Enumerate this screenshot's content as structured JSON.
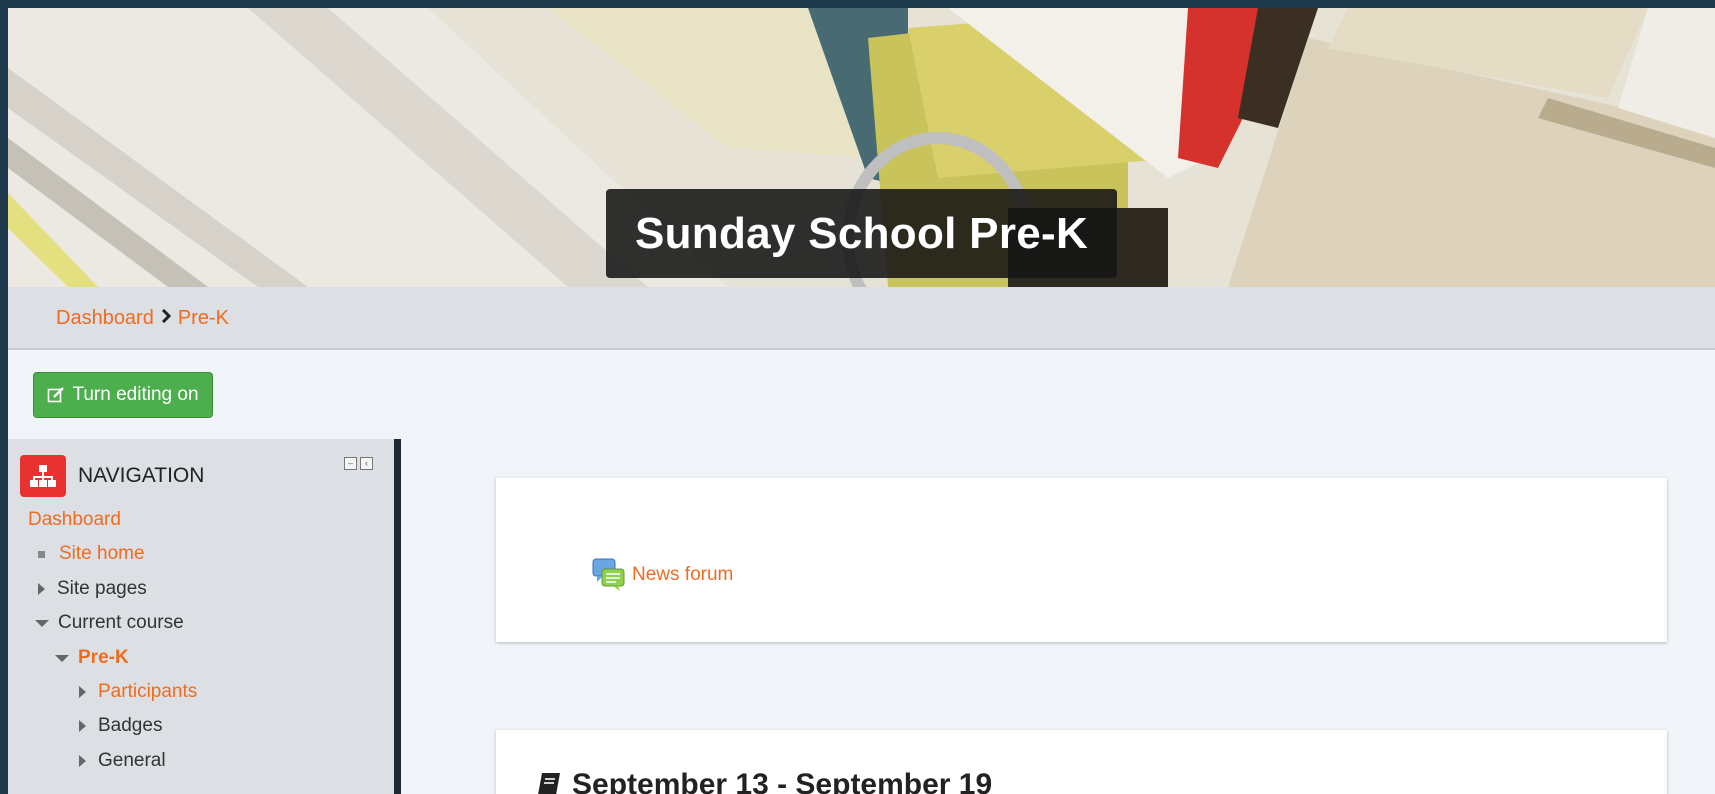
{
  "header": {
    "site_title": "Sunday School Pre-K"
  },
  "breadcrumb": {
    "items": [
      "Dashboard",
      "Pre-K"
    ],
    "separator": "›"
  },
  "toolbar": {
    "edit_label": "Turn editing on"
  },
  "navigation": {
    "title": "NAVIGATION",
    "items": [
      {
        "label": "Dashboard",
        "link": true,
        "marker": "none"
      },
      {
        "label": "Site home",
        "link": true,
        "marker": "bullet"
      },
      {
        "label": "Site pages",
        "link": false,
        "marker": "collapsed"
      },
      {
        "label": "Current course",
        "link": false,
        "marker": "expanded"
      },
      {
        "label": "Pre-K",
        "link": true,
        "marker": "expanded"
      },
      {
        "label": "Participants",
        "link": true,
        "marker": "collapsed"
      },
      {
        "label": "Badges",
        "link": false,
        "marker": "collapsed"
      },
      {
        "label": "General",
        "link": false,
        "marker": "collapsed"
      }
    ]
  },
  "main": {
    "news_forum_label": "News forum",
    "week_title": "September 13 - September 19"
  },
  "colors": {
    "accent": "#f26b1d",
    "button_green": "#4cae4c",
    "nav_logo_red": "#e8322f",
    "frame_bg": "#1e3a4c"
  }
}
